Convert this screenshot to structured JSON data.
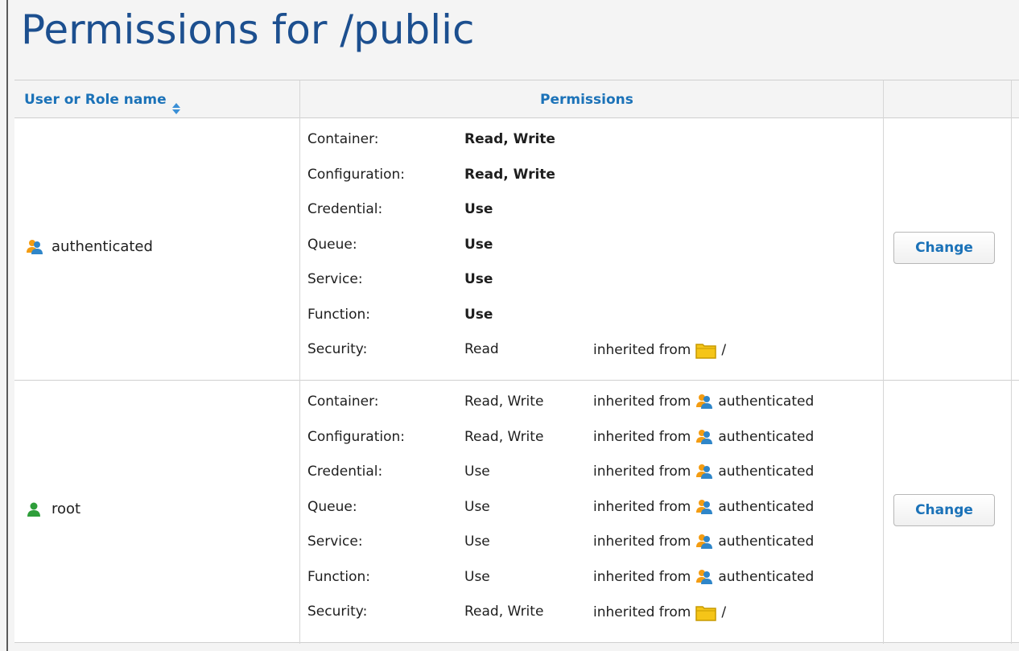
{
  "page": {
    "title": "Permissions for /public"
  },
  "table": {
    "headers": {
      "user": "User or Role name",
      "permissions": "Permissions",
      "actions": ""
    },
    "rows": [
      {
        "user": {
          "name": "authenticated",
          "icon": "group-icon"
        },
        "button_label": "Change",
        "permissions": [
          {
            "type": "Container:",
            "value": "Read, Write",
            "inherited_label": "",
            "inherited_from": ""
          },
          {
            "type": "Configuration:",
            "value": "Read, Write",
            "inherited_label": "",
            "inherited_from": ""
          },
          {
            "type": "Credential:",
            "value": "Use",
            "inherited_label": "",
            "inherited_from": ""
          },
          {
            "type": "Queue:",
            "value": "Use",
            "inherited_label": "",
            "inherited_from": ""
          },
          {
            "type": "Service:",
            "value": "Use",
            "inherited_label": "",
            "inherited_from": ""
          },
          {
            "type": "Function:",
            "value": "Use",
            "inherited_label": "",
            "inherited_from": ""
          },
          {
            "type": "Security:",
            "value": "Read",
            "inherited_label": "inherited from",
            "inherited_from": "/"
          }
        ]
      },
      {
        "user": {
          "name": "root",
          "icon": "user-icon"
        },
        "button_label": "Change",
        "permissions": [
          {
            "type": "Container:",
            "value": "Read, Write",
            "inherited_label": "inherited from",
            "inherited_from": "authenticated"
          },
          {
            "type": "Configuration:",
            "value": "Read, Write",
            "inherited_label": "inherited from",
            "inherited_from": "authenticated"
          },
          {
            "type": "Credential:",
            "value": "Use",
            "inherited_label": "inherited from",
            "inherited_from": "authenticated"
          },
          {
            "type": "Queue:",
            "value": "Use",
            "inherited_label": "inherited from",
            "inherited_from": "authenticated"
          },
          {
            "type": "Service:",
            "value": "Use",
            "inherited_label": "inherited from",
            "inherited_from": "authenticated"
          },
          {
            "type": "Function:",
            "value": "Use",
            "inherited_label": "inherited from",
            "inherited_from": "authenticated"
          },
          {
            "type": "Security:",
            "value": "Read, Write",
            "inherited_label": "inherited from",
            "inherited_from": "/"
          }
        ]
      }
    ]
  },
  "colors": {
    "title": "#1c4f8f",
    "link": "#1b72b8",
    "border": "#cfcfcf",
    "folder": "#f5c518"
  }
}
